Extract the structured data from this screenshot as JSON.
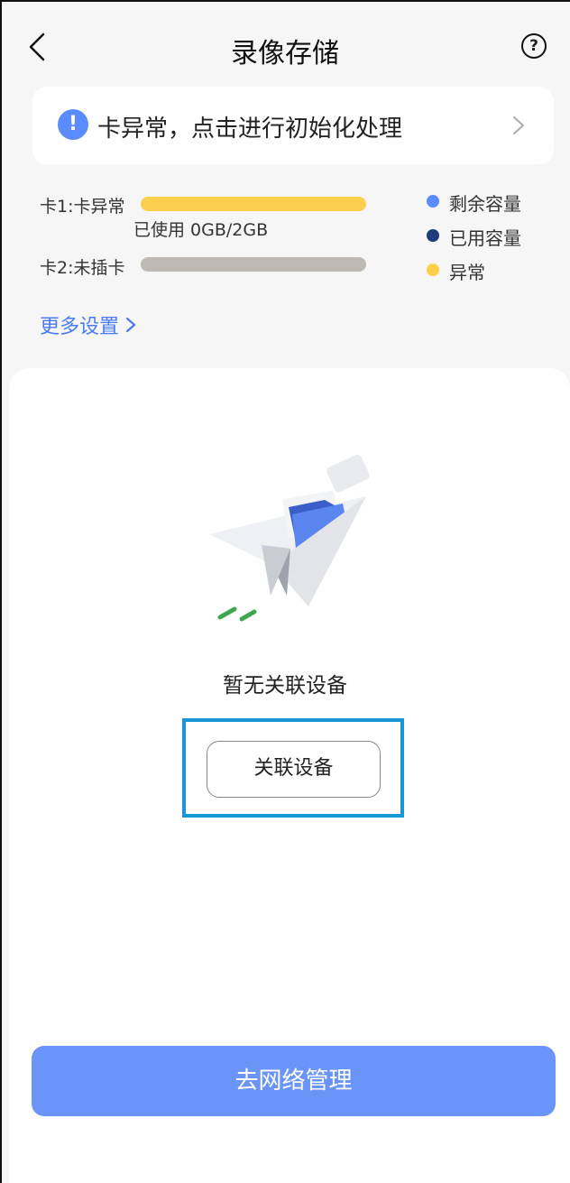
{
  "header": {
    "title": "录像存储",
    "back_icon": "chevron-left-icon",
    "help_icon": "question-circle-icon",
    "help_glyph": "?"
  },
  "alert": {
    "icon_glyph": "!",
    "text": "卡异常，点击进行初始化处理"
  },
  "storage": {
    "cards": [
      {
        "label": "卡1:卡异常",
        "status": "abnormal",
        "bar_color": "#fccf4d",
        "usage_text": "已使用 0GB/2GB"
      },
      {
        "label": "卡2:未插卡",
        "status": "not_inserted",
        "bar_color": "#bdbab4"
      }
    ],
    "legend": [
      {
        "label": "剩余容量",
        "color": "#5b8cff"
      },
      {
        "label": "已用容量",
        "color": "#1f3b7a"
      },
      {
        "label": "异常",
        "color": "#fccf4d"
      }
    ]
  },
  "more_settings": {
    "label": "更多设置"
  },
  "empty_state": {
    "text": "暂无关联设备",
    "button_label": "关联设备"
  },
  "footer": {
    "primary_button": "去网络管理"
  },
  "colors": {
    "accent": "#6b94f8",
    "link": "#4a7cf0",
    "highlight": "#1a96d6"
  }
}
